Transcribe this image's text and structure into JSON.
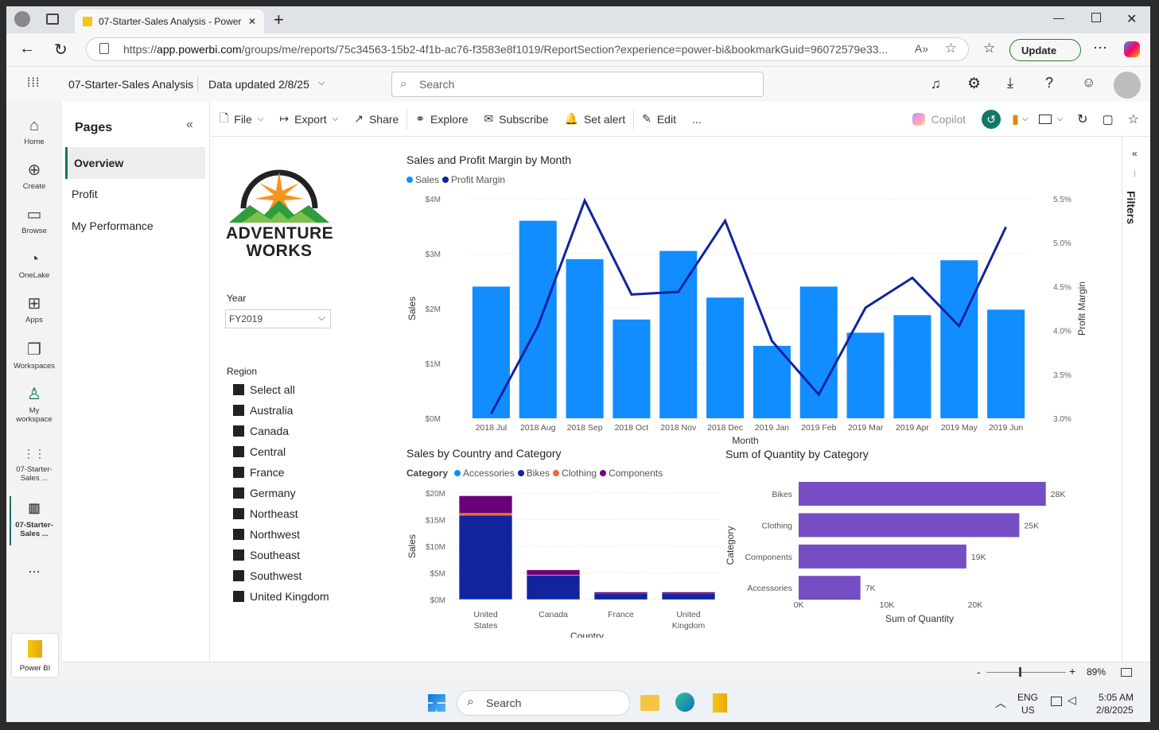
{
  "browser": {
    "tab_title": "07-Starter-Sales Analysis - Power",
    "url_prefix": "https://",
    "url_domain": "app.powerbi.com",
    "url_rest": "/groups/me/reports/75c34563-15b2-4f1b-ac76-f3583e8f1019/ReportSection?experience=power-bi&bookmarkGuid=96072579e33...",
    "update_label": "Update"
  },
  "header": {
    "report_name": "07-Starter-Sales Analysis",
    "data_updated": "Data updated 2/8/25",
    "search_placeholder": "Search"
  },
  "rail": [
    {
      "label": "Home",
      "icon": "home-icon"
    },
    {
      "label": "Create",
      "icon": "create-icon"
    },
    {
      "label": "Browse",
      "icon": "browse-icon"
    },
    {
      "label": "OneLake",
      "icon": "onelake-icon"
    },
    {
      "label": "Apps",
      "icon": "apps-icon"
    },
    {
      "label": "Workspaces",
      "icon": "workspaces-icon"
    },
    {
      "label": "My workspace",
      "icon": "my-workspace-icon"
    },
    {
      "label": "07-Starter-Sales ...",
      "icon": "report-icon"
    },
    {
      "label": "07-Starter-Sales ...",
      "icon": "report-icon"
    }
  ],
  "rail_more": "...",
  "powerbi_label": "Power BI",
  "pages": {
    "title": "Pages",
    "items": [
      "Overview",
      "Profit",
      "My Performance"
    ]
  },
  "toolbar": {
    "file": "File",
    "export": "Export",
    "share": "Share",
    "explore": "Explore",
    "subscribe": "Subscribe",
    "set_alert": "Set alert",
    "edit": "Edit",
    "more": "...",
    "copilot": "Copilot"
  },
  "filters_label": "Filters",
  "logo": {
    "line1": "Adventure",
    "line2": "Works"
  },
  "slicer_year": {
    "label": "Year",
    "value": "FY2019"
  },
  "slicer_region": {
    "label": "Region",
    "items": [
      "Select all",
      "Australia",
      "Canada",
      "Central",
      "France",
      "Germany",
      "Northeast",
      "Northwest",
      "Southeast",
      "Southwest",
      "United Kingdom"
    ]
  },
  "zoom": {
    "value": "89%",
    "minus": "-",
    "plus": "+"
  },
  "taskbar": {
    "search": "Search",
    "lang1": "ENG",
    "lang2": "US",
    "time": "5:05 AM",
    "date": "2/8/2025"
  },
  "colors": {
    "sales": "#118dff",
    "margin": "#12239e",
    "accessories": "#118dff",
    "bikes": "#12239e",
    "clothing": "#e66c37",
    "components": "#6b007b",
    "quantity": "#744ec2"
  },
  "chart_data": [
    {
      "type": "bar",
      "title": "Sales and Profit Margin by Month",
      "xlabel": "Month",
      "ylabel": "Sales",
      "y2label": "Profit Margin",
      "legend": [
        "Sales",
        "Profit Margin"
      ],
      "categories": [
        "2018 Jul",
        "2018 Aug",
        "2018 Sep",
        "2018 Oct",
        "2018 Nov",
        "2018 Dec",
        "2019 Jan",
        "2019 Feb",
        "2019 Mar",
        "2019 Apr",
        "2019 May",
        "2019 Jun"
      ],
      "series": [
        {
          "name": "Sales",
          "type": "bar",
          "values": [
            2.4,
            3.6,
            2.9,
            1.8,
            3.05,
            2.2,
            1.32,
            2.4,
            1.56,
            1.88,
            2.88,
            1.98
          ]
        },
        {
          "name": "Profit Margin",
          "type": "line",
          "axis": "right",
          "values": [
            3.05,
            4.05,
            5.48,
            4.41,
            4.44,
            5.25,
            3.88,
            3.27,
            4.26,
            4.6,
            4.05,
            5.18
          ]
        }
      ],
      "y_ticks": [
        "$0M",
        "$1M",
        "$2M",
        "$3M",
        "$4M"
      ],
      "ylim": [
        0,
        4
      ],
      "y2_ticks": [
        "3.0%",
        "3.5%",
        "4.0%",
        "4.5%",
        "5.0%",
        "5.5%"
      ],
      "y2lim": [
        3.0,
        5.5
      ]
    },
    {
      "type": "bar",
      "stacked": true,
      "title": "Sales by Country and Category",
      "xlabel": "Country",
      "ylabel": "Sales",
      "legend_title": "Category",
      "categories": [
        "United States",
        "Canada",
        "France",
        "United Kingdom"
      ],
      "series": [
        {
          "name": "Accessories",
          "values": [
            0.15,
            0.1,
            0.05,
            0.05
          ]
        },
        {
          "name": "Bikes",
          "values": [
            15.6,
            4.4,
            1.1,
            1.1
          ]
        },
        {
          "name": "Clothing",
          "values": [
            0.5,
            0.15,
            0.04,
            0.04
          ]
        },
        {
          "name": "Components",
          "values": [
            3.2,
            0.9,
            0.2,
            0.2
          ]
        }
      ],
      "y_ticks": [
        "$0M",
        "$5M",
        "$10M",
        "$15M",
        "$20M"
      ],
      "ylim": [
        0,
        20
      ]
    },
    {
      "type": "bar",
      "orientation": "horizontal",
      "title": "Sum of Quantity by Category",
      "xlabel": "Sum of Quantity",
      "ylabel": "Category",
      "categories": [
        "Bikes",
        "Clothing",
        "Components",
        "Accessories"
      ],
      "values": [
        28,
        25,
        19,
        7
      ],
      "data_labels": [
        "28K",
        "25K",
        "19K",
        "7K"
      ],
      "x_ticks": [
        "0K",
        "10K",
        "20K"
      ],
      "xlim": [
        0,
        28
      ]
    }
  ]
}
